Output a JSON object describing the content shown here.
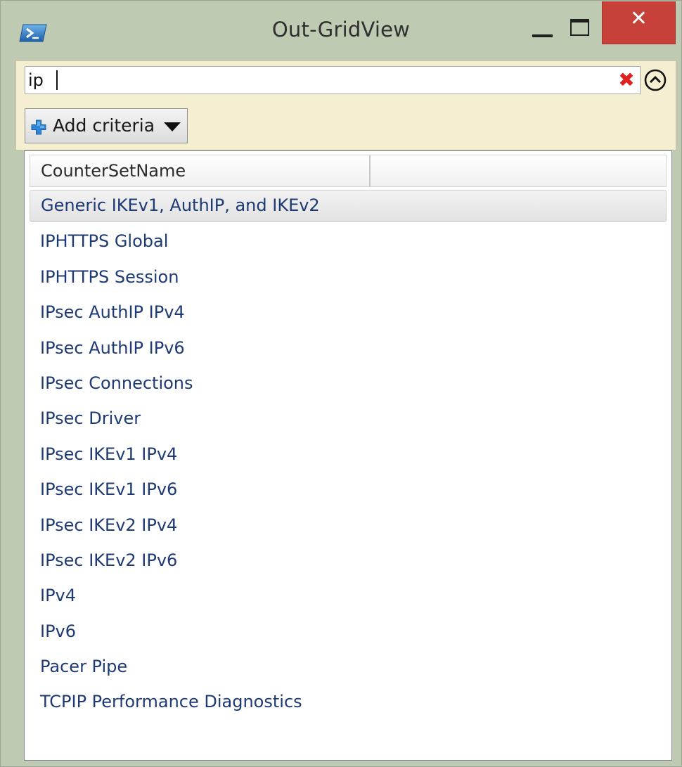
{
  "window": {
    "title": "Out-GridView",
    "close_glyph": "✕",
    "icons": {
      "app": "powershell-icon",
      "minimize": "minimize-icon",
      "maximize": "maximize-icon",
      "close": "close-icon"
    }
  },
  "filter": {
    "search_value": "ip",
    "clear_glyph": "✖",
    "add_criteria_label": "Add criteria",
    "icons": {
      "clear": "clear-x-icon",
      "collapse": "chevron-up-circle-icon",
      "add": "plus-icon",
      "dropdown": "triangle-down-icon"
    }
  },
  "grid": {
    "columns": [
      "CounterSetName",
      ""
    ],
    "rows": [
      "Generic IKEv1, AuthIP, and IKEv2",
      "IPHTTPS Global",
      "IPHTTPS Session",
      "IPsec AuthIP IPv4",
      "IPsec AuthIP IPv6",
      "IPsec Connections",
      "IPsec Driver",
      "IPsec IKEv1 IPv4",
      "IPsec IKEv1 IPv6",
      "IPsec IKEv2 IPv4",
      "IPsec IKEv2 IPv6",
      "IPv4",
      "IPv6",
      "Pacer Pipe",
      "TCPIP Performance Diagnostics"
    ],
    "selected_row": 0
  },
  "colors": {
    "chrome": "#bfcab3",
    "filter_panel": "#f4efd0",
    "close_button": "#c7413a",
    "row_text": "#1e3a74",
    "clear_x": "#e02020",
    "plus_blue": "#2e86d6"
  }
}
